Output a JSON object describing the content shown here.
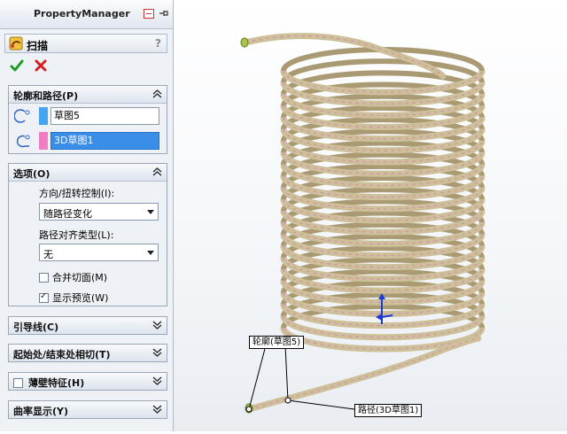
{
  "panel": {
    "title": "PropertyManager",
    "feature_name": "扫描",
    "help": "?",
    "groups": {
      "profile_path": {
        "title": "轮廓和路径(P)",
        "profile_value": "草图5",
        "path_value": "3D草图1",
        "profile_color": "#44a5f3",
        "path_color": "#f07cc2"
      },
      "options": {
        "title": "选项(O)",
        "orient_label": "方向/扭转控制(I):",
        "orient_value": "随路径变化",
        "align_label": "路径对齐类型(L):",
        "align_value": "无",
        "merge_label": "合并切面(M)",
        "merge_checked": false,
        "preview_label": "显示预览(W)",
        "preview_checked": true
      },
      "guides": {
        "title": "引导线(C)"
      },
      "tangency": {
        "title": "起始处/结束处相切(T)"
      },
      "thin": {
        "title": "薄壁特征(H)"
      },
      "curvature": {
        "title": "曲率显示(Y)"
      }
    }
  },
  "viewport": {
    "callout_profile": "轮廓(草图5)",
    "callout_path": "路径(3D草图1)",
    "coil_color": "#cdbf98",
    "coil_accent": "#d48ab5"
  }
}
